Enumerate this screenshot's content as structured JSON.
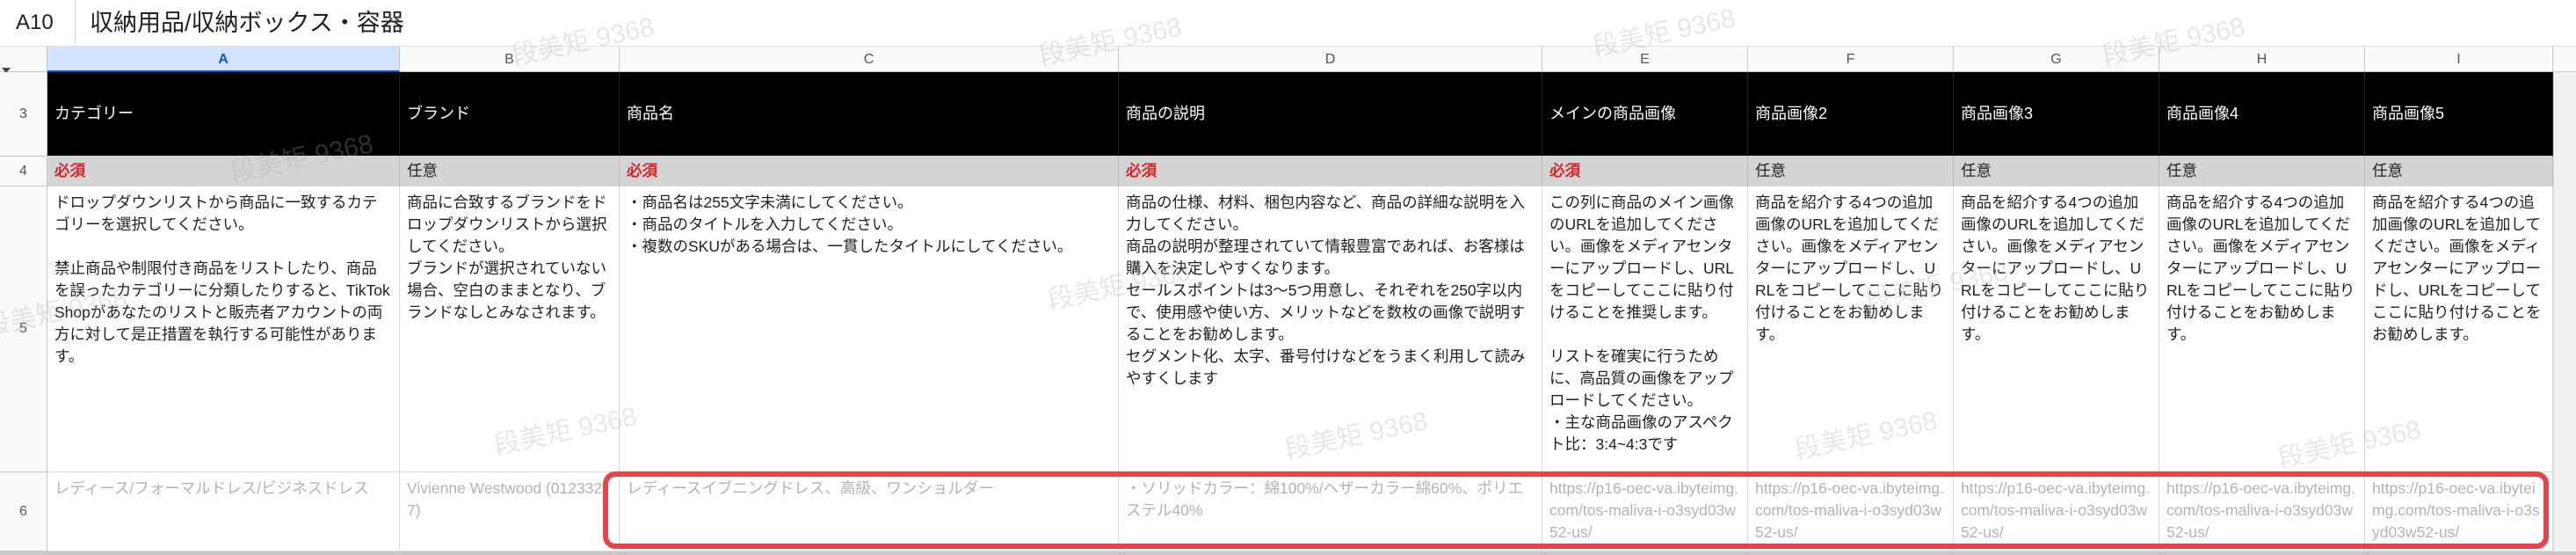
{
  "formula_bar": {
    "cell_ref": "A10",
    "content": "収納用品/収納ボックス・容器"
  },
  "columns": [
    "A",
    "B",
    "C",
    "D",
    "E",
    "F",
    "G",
    "H",
    "I"
  ],
  "selected_column": "A",
  "rows": {
    "r3": {
      "label": "3"
    },
    "r4": {
      "label": "4"
    },
    "r5": {
      "label": "5"
    },
    "r6": {
      "label": "6"
    }
  },
  "headers": [
    "カテゴリー",
    "ブランド",
    "商品名",
    "商品の説明",
    "メインの商品画像",
    "商品画像2",
    "商品画像3",
    "商品画像4",
    "商品画像5"
  ],
  "requirements": [
    "必須",
    "任意",
    "必須",
    "必須",
    "必須",
    "任意",
    "任意",
    "任意",
    "任意"
  ],
  "instructions": [
    "ドロップダウンリストから商品に一致するカテゴリーを選択してください。\n\n禁止商品や制限付き商品をリストしたり、商品を誤ったカテゴリーに分類したりすると、TikTok Shopがあなたのリストと販売者アカウントの両方に対して是正措置を執行する可能性があります。",
    "商品に合致するブランドをドロップダウンリストから選択してください。\nブランドが選択されていない場合、空白のままとなり、ブランドなしとみなされます。",
    "・商品名は255文字未満にしてください。\n・商品のタイトルを入力してください。\n・複数のSKUがある場合は、一貫したタイトルにしてください。",
    "商品の仕様、材料、梱包内容など、商品の詳細な説明を入力してください。\n商品の説明が整理されていて情報豊富であれば、お客様は購入を決定しやすくなります。\nセールスポイントは3〜5つ用意し、それぞれを250字以内で、使用感や使い方、メリットなどを数枚の画像で説明することをお勧めします。\nセグメント化、太字、番号付けなどをうまく利用して読みやすくします",
    "この列に商品のメイン画像のURLを追加してください。画像をメディアセンターにアップロードし、URLをコピーしてここに貼り付けることを推奨します。\n\nリストを確実に行うために、高品質の画像をアップロードしてください。\n・主な商品画像のアスペクト比：3:4~4:3です",
    "商品を紹介する4つの追加画像のURLを追加してください。画像をメディアセンターにアップロードし、URLをコピーしてここに貼り付けることをお勧めします。",
    "商品を紹介する4つの追加画像のURLを追加してください。画像をメディアセンターにアップロードし、URLをコピーしてここに貼り付けることをお勧めします。",
    "商品を紹介する4つの追加画像のURLを追加してください。画像をメディアセンターにアップロードし、URLをコピーしてここに貼り付けることをお勧めします。",
    "商品を紹介する4つの追加画像のURLを追加してください。画像をメディアセンターにアップロードし、URLをコピーしてここに貼り付けることをお勧めします。"
  ],
  "example_row": [
    "レディース/フォーマルドレス/ビジネスドレス",
    "Vivienne Westwood (0123327)",
    "レディースイブニングドレス、高級、ワンショルダー",
    "・ソリッドカラー：綿100%/ヘザーカラー綿60%、ポリエステル40%",
    "https://p16-oec-va.ibyteimg.com/tos-maliva-i-o3syd03w52-us/",
    "https://p16-oec-va.ibyteimg.com/tos-maliva-i-o3syd03w52-us/",
    "https://p16-oec-va.ibyteimg.com/tos-maliva-i-o3syd03w52-us/",
    "https://p16-oec-va.ibyteimg.com/tos-maliva-i-o3syd03w52-us/",
    "https://p16-oec-va.ibyteimg.com/tos-maliva-i-o3syd03w52-us/"
  ],
  "watermark_text": "段美矩 9368",
  "colors": {
    "header_bg": "#000000",
    "required_text": "#d7262b",
    "requirement_row_bg": "#d4d4d4",
    "highlight_border": "#e8424a",
    "selected_column": "#d3e3fd"
  }
}
